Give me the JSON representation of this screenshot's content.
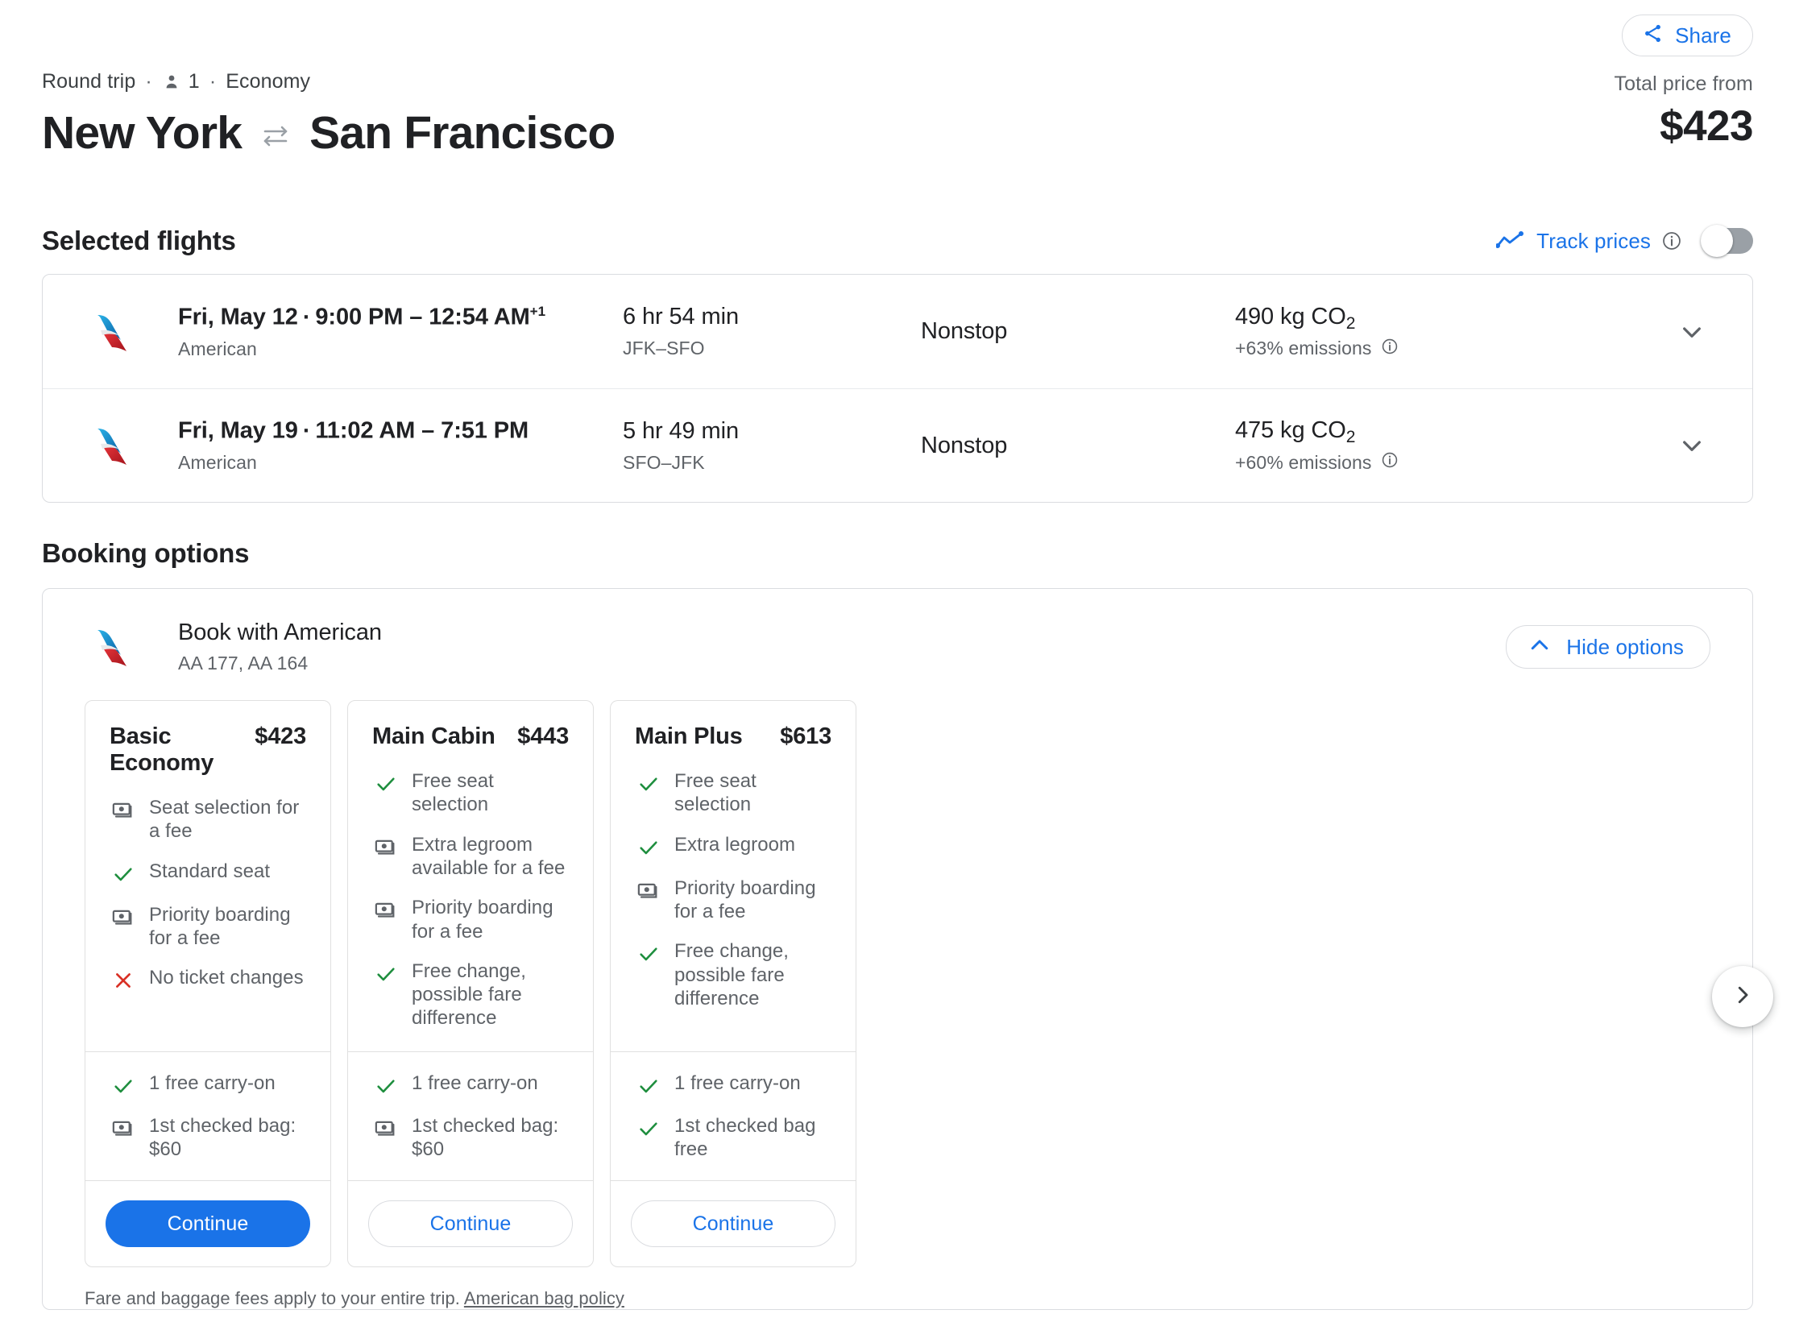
{
  "header": {
    "share_label": "Share",
    "share_icon": "share-icon",
    "trip_type": "Round trip",
    "passengers": "1",
    "cabin": "Economy",
    "separator": "·",
    "origin": "New York",
    "destination": "San Francisco",
    "swap_icon": "swap-arrows-icon",
    "price_label": "Total price from",
    "price_value": "$423"
  },
  "selected_flights": {
    "title": "Selected flights",
    "track_prices_label": "Track prices",
    "track_icon": "trending-line-icon",
    "info_icon": "info-icon",
    "toggle_state": "off",
    "rows": [
      {
        "airline_logo": "american-airlines-logo",
        "date": "Fri, May 12",
        "separator": "·",
        "time": "9:00 PM – 12:54 AM",
        "day_offset": "+1",
        "airline": "American",
        "duration": "6 hr 54 min",
        "route": "JFK–SFO",
        "stops": "Nonstop",
        "co2": "490 kg CO",
        "co2_sub": "2",
        "emissions": "+63% emissions",
        "expand_icon": "chevron-down-icon"
      },
      {
        "airline_logo": "american-airlines-logo",
        "date": "Fri, May 19",
        "separator": "·",
        "time": "11:02 AM – 7:51 PM",
        "day_offset": "",
        "airline": "American",
        "duration": "5 hr 49 min",
        "route": "SFO–JFK",
        "stops": "Nonstop",
        "co2": "475 kg CO",
        "co2_sub": "2",
        "emissions": "+60% emissions",
        "expand_icon": "chevron-down-icon"
      }
    ]
  },
  "booking_options": {
    "title": "Booking options",
    "provider_logo": "american-airlines-logo",
    "provider_title": "Book with American",
    "flight_numbers": "AA 177, AA 164",
    "hide_options_label": "Hide options",
    "hide_options_icon": "chevron-up-icon",
    "next_icon": "chevron-right-icon",
    "footnote_text": "Fare and baggage fees apply to your entire trip.",
    "footnote_link": "American bag policy",
    "fares": [
      {
        "name": "Basic Economy",
        "price": "$423",
        "features": [
          {
            "icon": "money-icon",
            "text": "Seat selection for a fee"
          },
          {
            "icon": "check-icon",
            "text": "Standard seat"
          },
          {
            "icon": "money-icon",
            "text": "Priority boarding for a fee"
          },
          {
            "icon": "cross-icon",
            "text": "No ticket changes"
          }
        ],
        "bags": [
          {
            "icon": "check-icon",
            "text": "1 free carry-on"
          },
          {
            "icon": "money-icon",
            "text": "1st checked bag: $60"
          }
        ],
        "cta_label": "Continue",
        "cta_style": "primary"
      },
      {
        "name": "Main Cabin",
        "price": "$443",
        "features": [
          {
            "icon": "check-icon",
            "text": "Free seat selection"
          },
          {
            "icon": "money-icon",
            "text": "Extra legroom available for a fee"
          },
          {
            "icon": "money-icon",
            "text": "Priority boarding for a fee"
          },
          {
            "icon": "check-icon",
            "text": "Free change, possible fare difference"
          }
        ],
        "bags": [
          {
            "icon": "check-icon",
            "text": "1 free carry-on"
          },
          {
            "icon": "money-icon",
            "text": "1st checked bag: $60"
          }
        ],
        "cta_label": "Continue",
        "cta_style": "secondary"
      },
      {
        "name": "Main Plus",
        "price": "$613",
        "features": [
          {
            "icon": "check-icon",
            "text": "Free seat selection"
          },
          {
            "icon": "check-icon",
            "text": "Extra legroom"
          },
          {
            "icon": "money-icon",
            "text": "Priority boarding for a fee"
          },
          {
            "icon": "check-icon",
            "text": "Free change, possible fare difference"
          }
        ],
        "bags": [
          {
            "icon": "check-icon",
            "text": "1 free carry-on"
          },
          {
            "icon": "check-icon",
            "text": "1st checked bag free"
          }
        ],
        "cta_label": "Continue",
        "cta_style": "secondary"
      }
    ]
  },
  "colors": {
    "accent_blue": "#1a73e8",
    "check_green": "#1e8e3e",
    "cross_red": "#d93025",
    "text_primary": "#202124",
    "text_secondary": "#5f6368",
    "border": "#dadce0"
  }
}
